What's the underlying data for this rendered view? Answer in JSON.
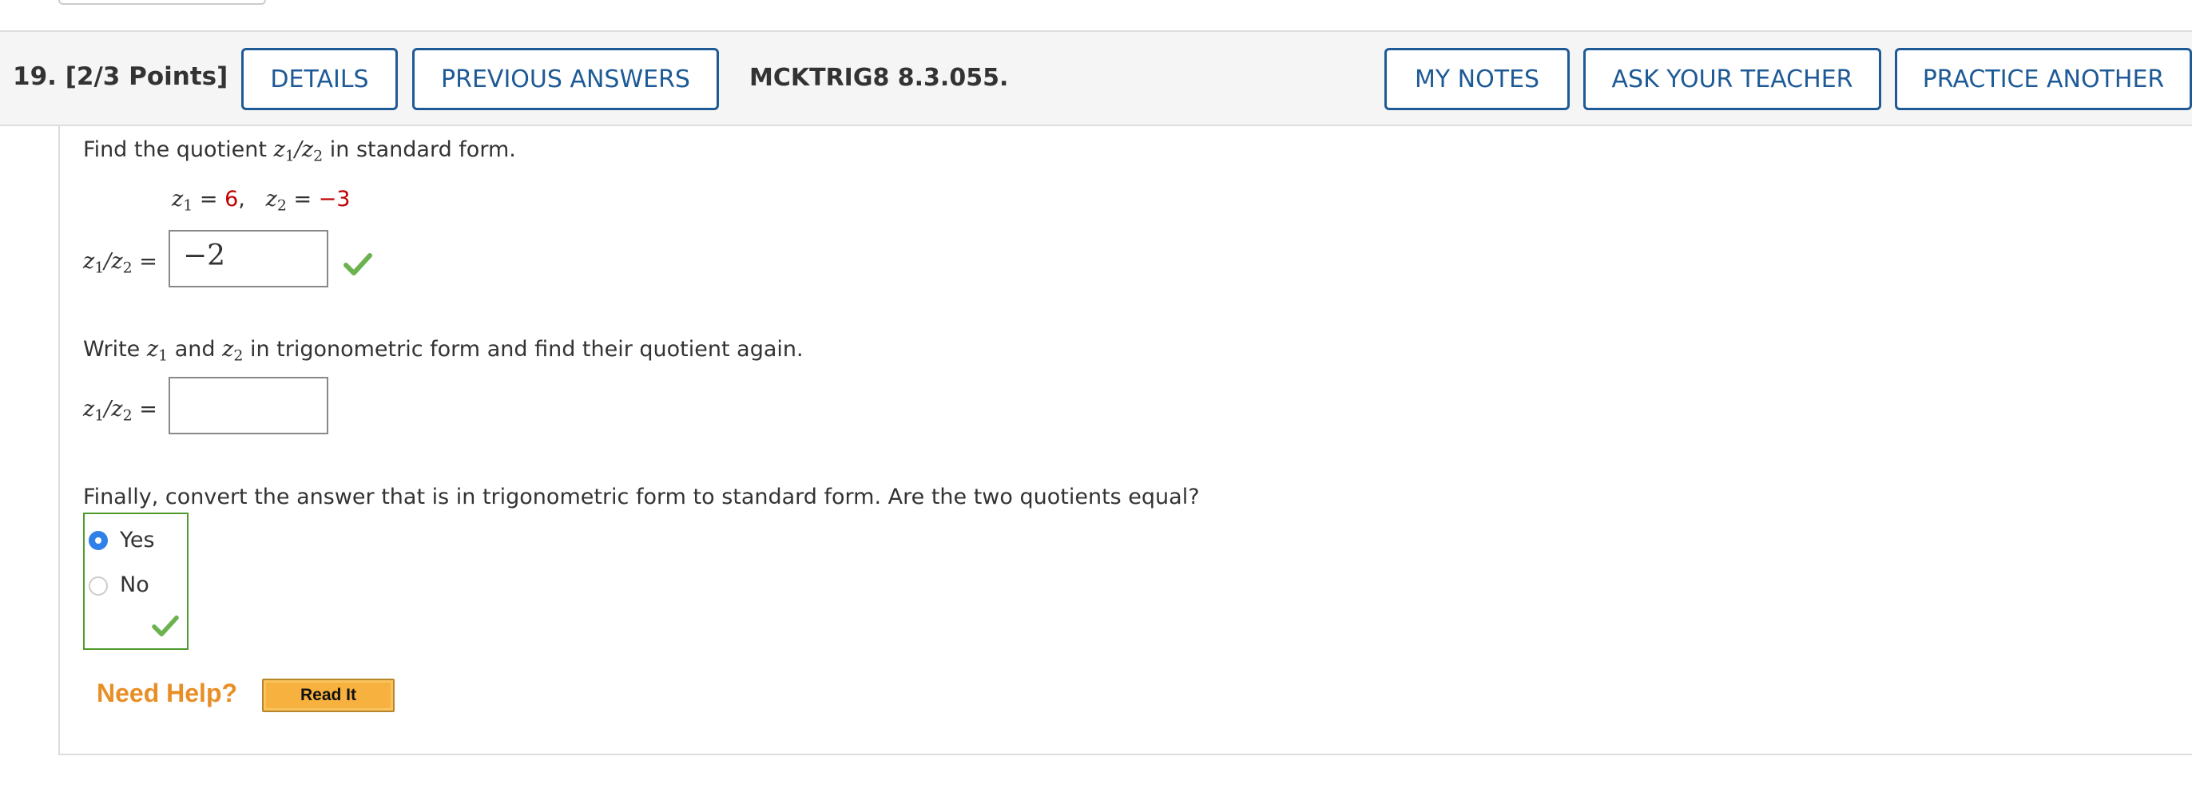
{
  "question": {
    "number_points": "19.  [2/3 Points]",
    "code": "MCKTRIG8 8.3.055."
  },
  "buttons": {
    "details": "DETAILS",
    "previous_answers": "PREVIOUS ANSWERS",
    "my_notes": "MY NOTES",
    "ask_teacher": "ASK YOUR TEACHER",
    "practice_another": "PRACTICE ANOTHER"
  },
  "part1": {
    "prompt_before": "Find the quotient ",
    "prompt_after": " in standard form.",
    "z1_value": "6",
    "z2_value": "−3",
    "answer_value": "−2"
  },
  "part2": {
    "prompt_start": "Write ",
    "prompt_and": " and ",
    "prompt_end": " in trigonometric form and find their quotient again.",
    "answer_value": ""
  },
  "part3": {
    "prompt": "Finally, convert the answer that is in trigonometric form to standard form. Are the two quotients equal?",
    "options": [
      "Yes",
      "No"
    ],
    "selected": "Yes"
  },
  "help": {
    "label": "Need Help?",
    "read_it": "Read It"
  },
  "colors": {
    "accent": "#1e5a96",
    "correct": "#4f9a2a",
    "given_value": "#c00000",
    "help": "#e88e25"
  },
  "icons": [
    "checkmark-icon",
    "radio-selected-icon",
    "radio-unselected-icon"
  ]
}
